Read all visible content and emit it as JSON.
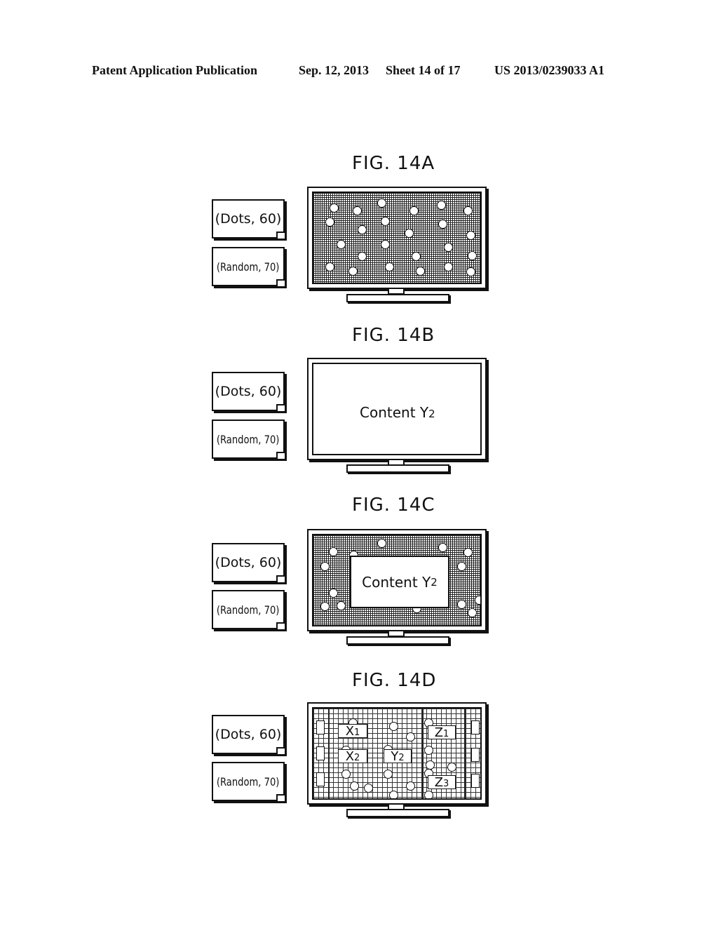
{
  "header": {
    "left": "Patent Application Publication",
    "date": "Sep. 12, 2013",
    "sheet": "Sheet 14 of 17",
    "number": "US 2013/0239033 A1"
  },
  "figures": [
    {
      "title": "FIG. 14A",
      "cards": [
        "(Dots, 60)",
        "(Random, 70)"
      ],
      "screen": "dots-pattern"
    },
    {
      "title": "FIG. 14B",
      "cards": [
        "(Dots, 60)",
        "(Random, 70)"
      ],
      "screen": "content",
      "content_label": "Content Y",
      "content_sub": "2"
    },
    {
      "title": "FIG. 14C",
      "cards": [
        "(Dots, 60)",
        "(Random, 70)"
      ],
      "screen": "dots-with-content",
      "content_label": "Content Y",
      "content_sub": "2"
    },
    {
      "title": "FIG. 14D",
      "cards": [
        "(Dots, 60)",
        "(Random, 70)"
      ],
      "screen": "multi-window",
      "tags": [
        {
          "letter": "X",
          "sub": "1"
        },
        {
          "letter": "X",
          "sub": "2"
        },
        {
          "letter": "Y",
          "sub": "2"
        },
        {
          "letter": "Z",
          "sub": "1"
        },
        {
          "letter": "Z",
          "sub": "3"
        }
      ]
    }
  ]
}
